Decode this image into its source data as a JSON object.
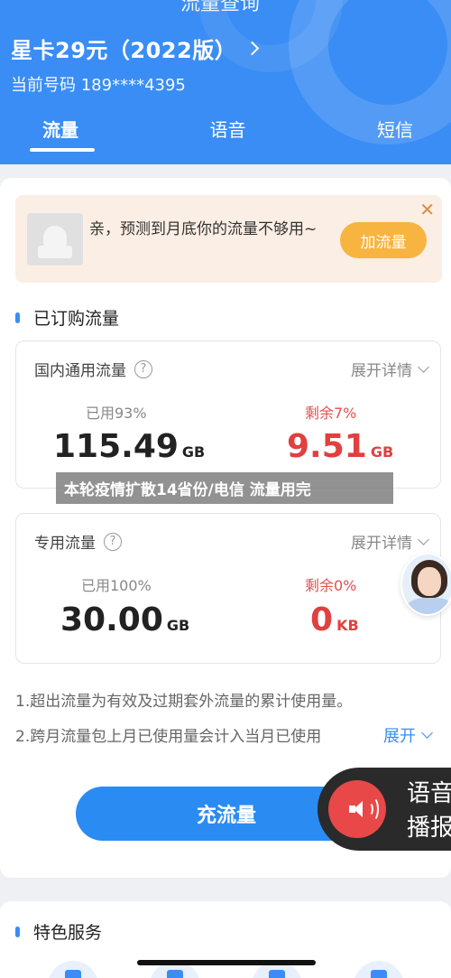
{
  "header": {
    "top_title_partial": "流量查询",
    "plan_name": "星卡29元（2022版）",
    "phone_label": "当前号码 189****4395",
    "tabs": [
      {
        "label": "流量",
        "active": true
      },
      {
        "label": "语音",
        "active": false
      },
      {
        "label": "短信",
        "active": false
      }
    ]
  },
  "banner": {
    "message": "亲，预测到月底你的流量不够用~",
    "button_label": "加流量",
    "close_symbol": "✕"
  },
  "section_subscribed": {
    "title": "已订购流量"
  },
  "domestic": {
    "label": "国内通用流量",
    "help_symbol": "?",
    "expand_label": "展开详情",
    "used_label": "已用93%",
    "used_value": "115.49",
    "used_unit": "GB",
    "remain_label": "剩余7%",
    "remain_value": "9.51",
    "remain_unit": "GB"
  },
  "dedicated": {
    "label": "专用流量",
    "help_symbol": "?",
    "expand_label": "展开详情",
    "used_label": "已用100%",
    "used_value": "30.00",
    "used_unit": "GB",
    "remain_label": "剩余0%",
    "remain_value": "0",
    "remain_unit": "KB"
  },
  "overlay_caption": "本轮疫情扩散14省份/电信 流量用完",
  "notes": {
    "line1": "1.超出流量为有效及过期套外流量的累计使用量。",
    "line2": "2.跨月流量包上月已使用量会计入当月已使用",
    "expand_label": "展开"
  },
  "charge_button": "充流量",
  "voice_broadcast": {
    "line1": "语音",
    "line2": "播报"
  },
  "section_services": {
    "title": "特色服务"
  },
  "colors": {
    "brand_blue": "#3a8df4",
    "warning_red": "#e04040",
    "banner_orange": "#f8b440",
    "voice_bg": "#2a2a2a"
  }
}
